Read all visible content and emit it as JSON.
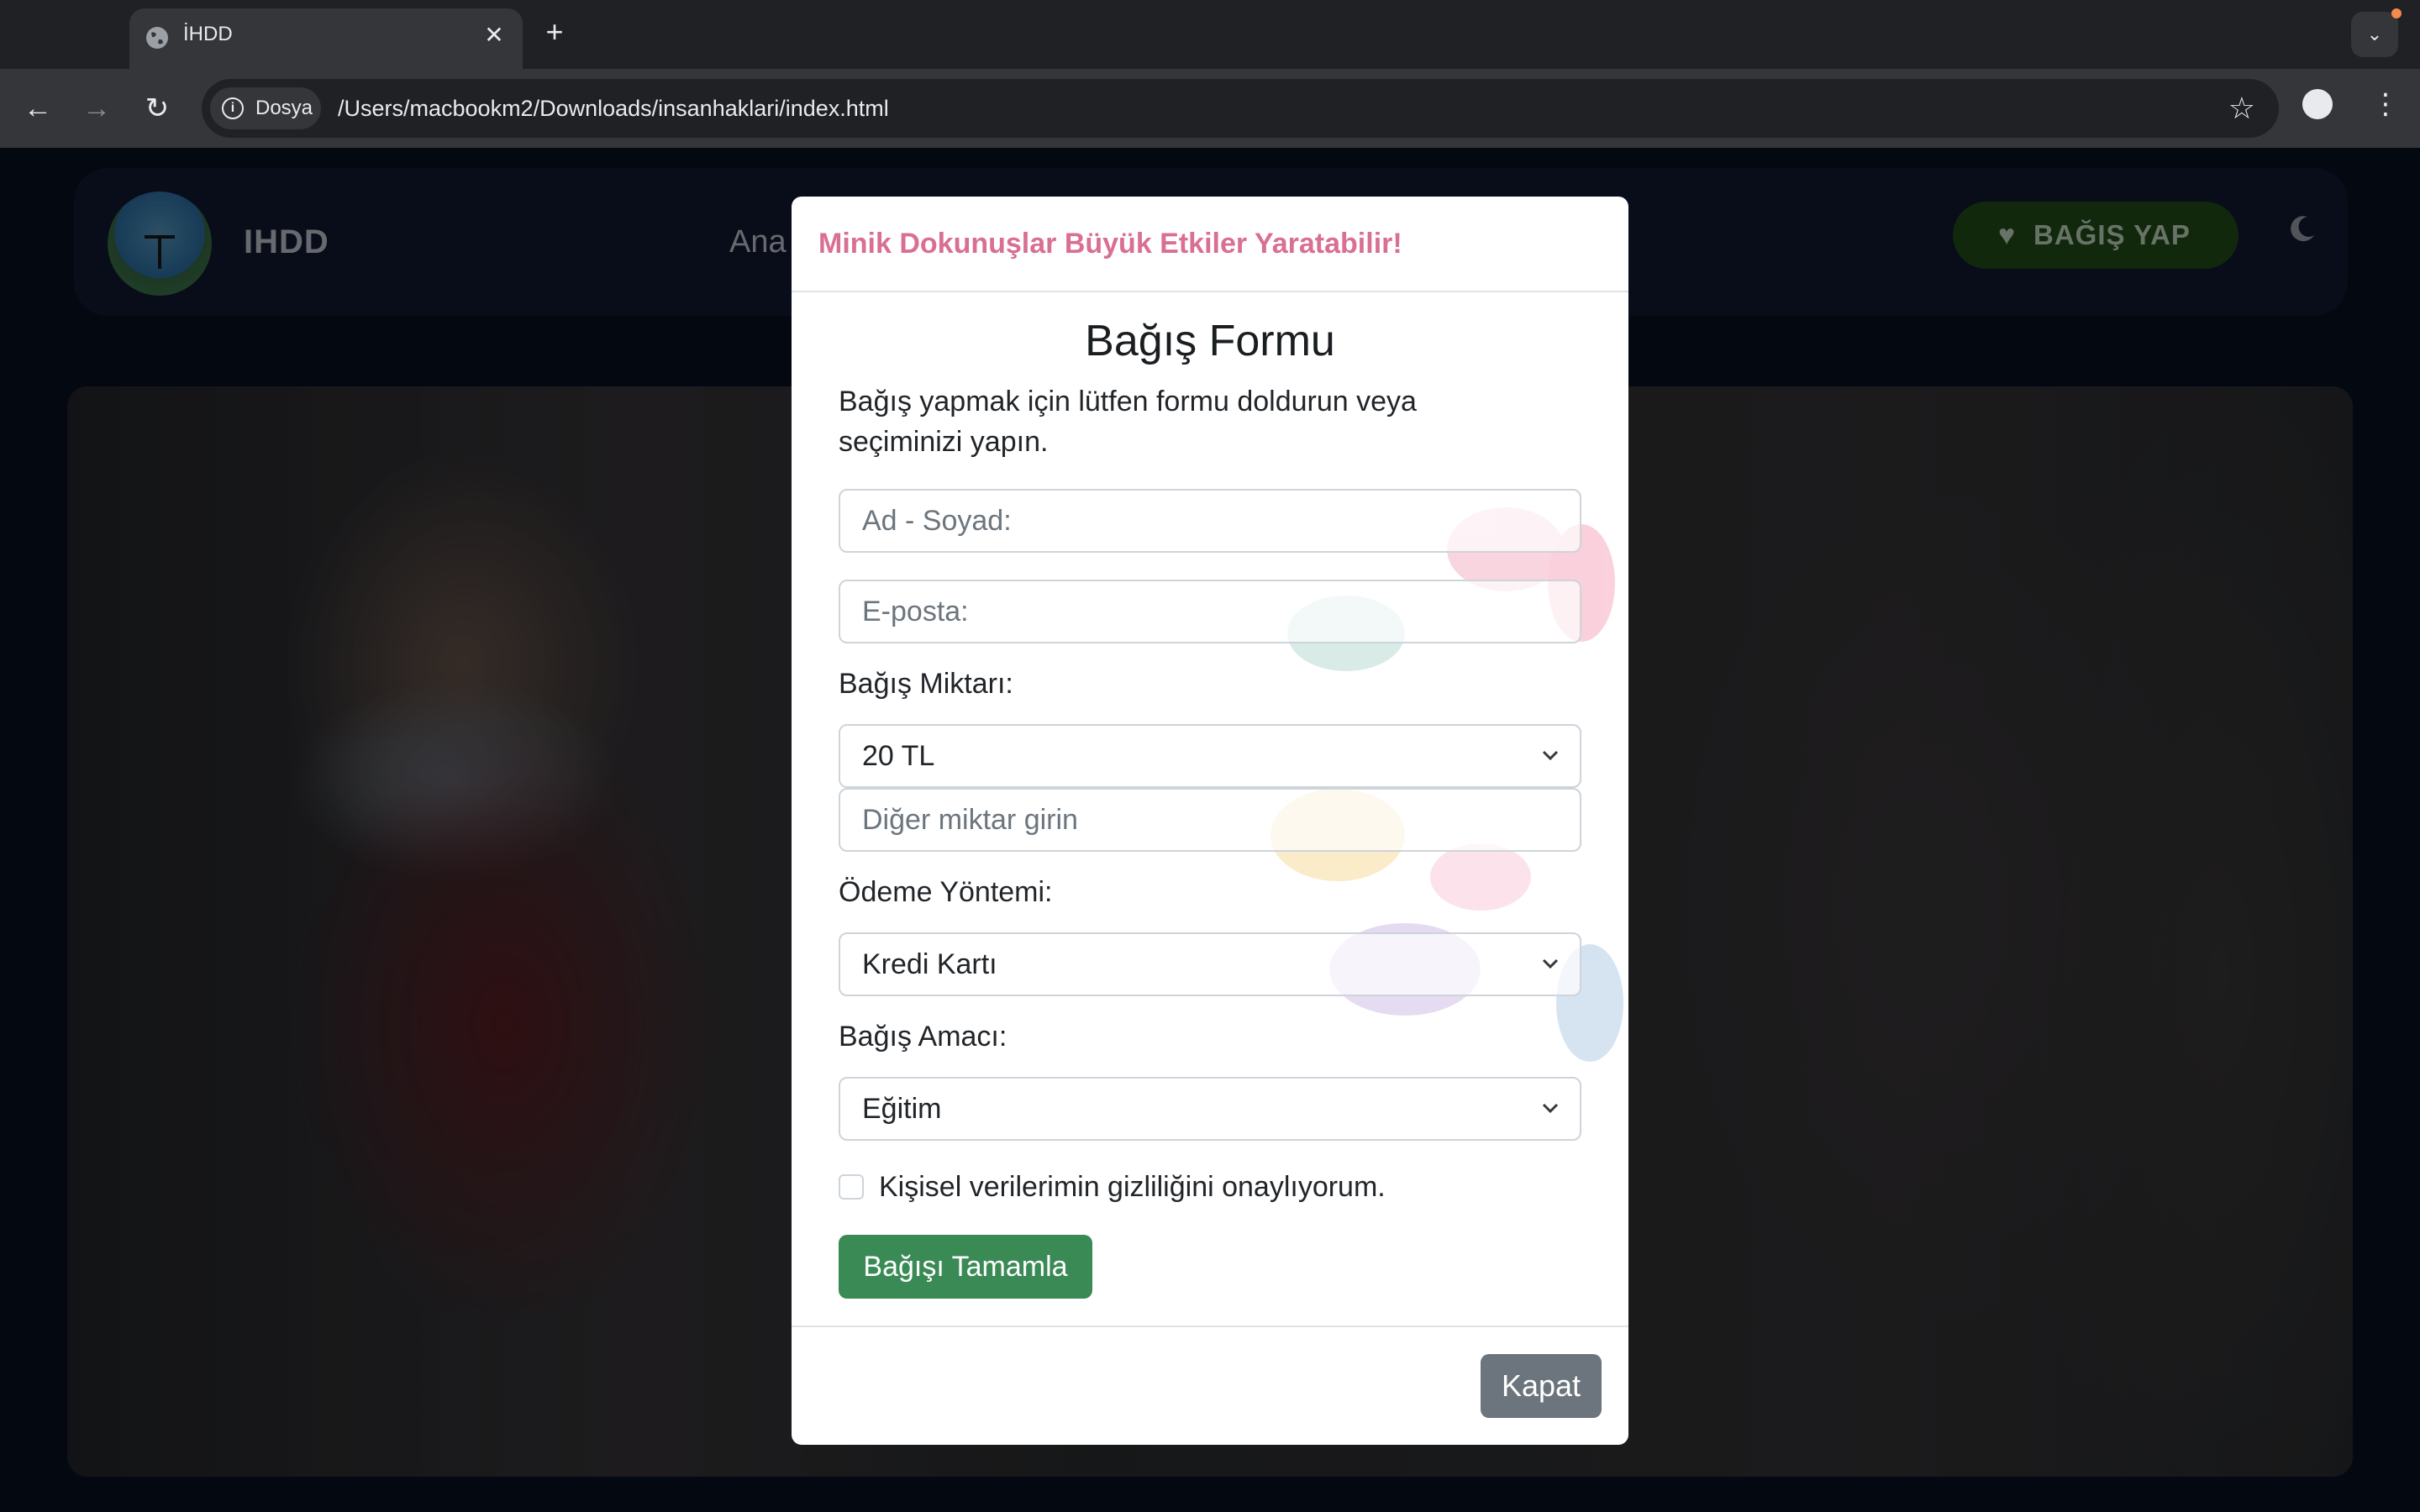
{
  "browser": {
    "tab_title": "İHDD",
    "chip_label": "Dosya",
    "url": "/Users/macbookm2/Downloads/insanhaklari/index.html",
    "new_tab_symbol": "+",
    "close_symbol": "✕"
  },
  "site": {
    "brand": "IHDD",
    "nav_partial": "Ana",
    "donate_button": "BAĞIŞ YAP"
  },
  "modal": {
    "slogan": "Minik Dokunuşlar Büyük Etkiler Yaratabilir!",
    "title": "Bağış Formu",
    "description": "Bağış yapmak için lütfen formu doldurun veya seçiminizi yapın.",
    "name_placeholder": "Ad - Soyad:",
    "email_placeholder": "E-posta:",
    "amount_label": "Bağış Miktarı:",
    "amount_value": "20 TL",
    "other_amount_placeholder": "Diğer miktar girin",
    "payment_label": "Ödeme Yöntemi:",
    "payment_value": "Kredi Kartı",
    "purpose_label": "Bağış Amacı:",
    "purpose_value": "Eğitim",
    "privacy_label": "Kişisel verilerimin gizliliğini onaylıyorum.",
    "privacy_checked": false,
    "submit_label": "Bağışı Tamamla",
    "close_label": "Kapat"
  },
  "colors": {
    "slogan": "#d96f93",
    "submit": "#3a8a56",
    "close": "#6c757d",
    "donate_bg": "#173612"
  }
}
